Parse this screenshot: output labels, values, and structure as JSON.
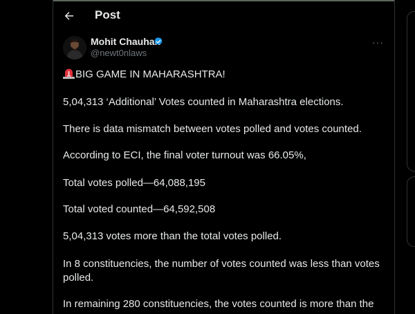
{
  "header": {
    "title": "Post",
    "back_icon": "arrow-left-icon"
  },
  "author": {
    "name": "Mohit Chauhan",
    "handle": "@newt0nlaws",
    "verified": true,
    "verified_color": "#1d9bf0"
  },
  "more_icon": "ellipsis-icon",
  "more_label": "···",
  "post": {
    "headline_icon": "rotating-light-icon",
    "lines": [
      "BIG GAME IN MAHARASHTRA!",
      "5,04,313 ‘Additional’ Votes counted in Maharashtra elections.",
      "There is data mismatch between votes polled and votes counted.",
      "According to ECI, the final voter turnout was 66.05%,",
      "Total votes polled—64,088,195",
      "Total voted counted—64,592,508",
      "5,04,313 votes more than the total votes polled.",
      "In 8 constituencies, the number of votes counted was less than votes",
      "polled.",
      "In remaining 280 constituencies, the votes counted is more than the"
    ]
  },
  "colors": {
    "background": "#000000",
    "text": "#e7e9ea",
    "muted": "#71767b",
    "border": "#2f3336",
    "accent": "#1d9bf0"
  }
}
